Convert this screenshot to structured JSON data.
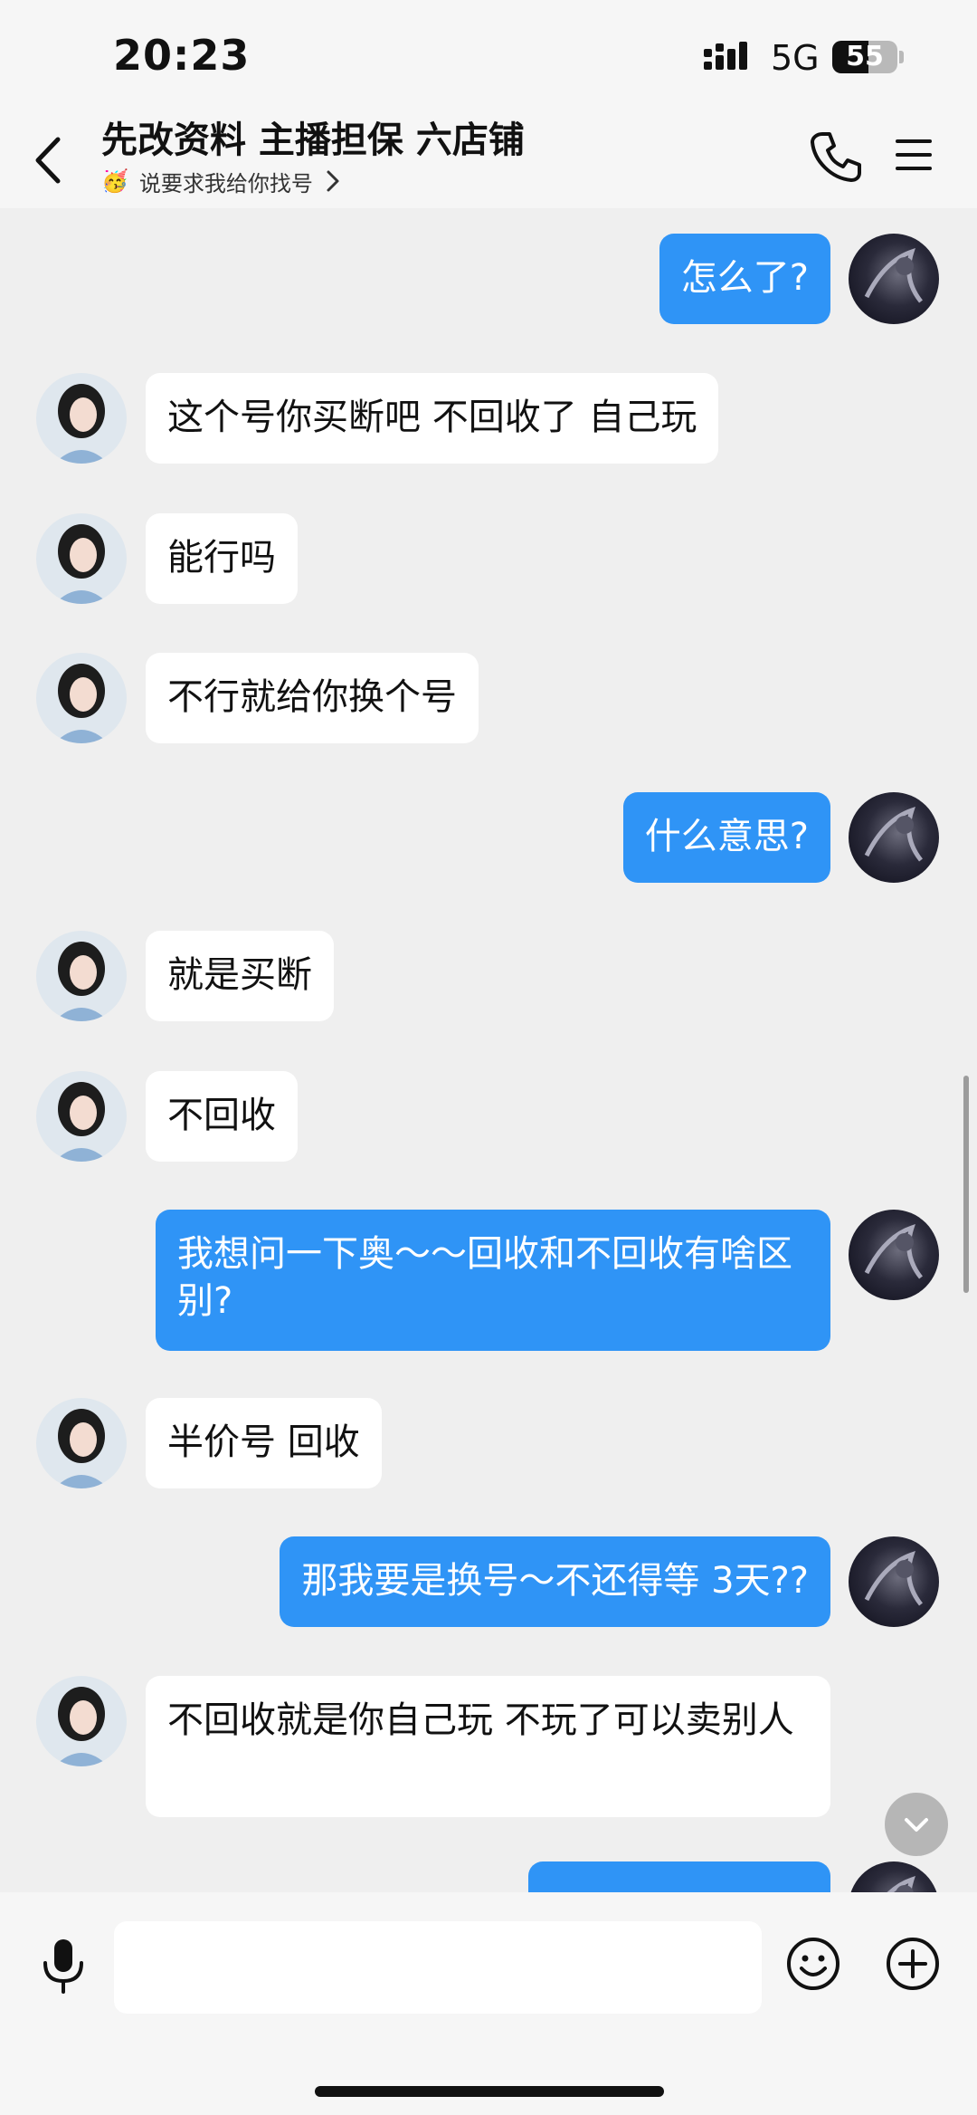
{
  "status_bar": {
    "time": "20:23",
    "network": "5G",
    "battery": "55",
    "battery_level": 0.55
  },
  "header": {
    "title": "先改资料 主播担保 六店铺",
    "subtitle_emoji": "🥳",
    "subtitle": "说要求我给你找号"
  },
  "messages": [
    {
      "side": "right",
      "text": "怎么了?"
    },
    {
      "side": "left",
      "text": "这个号你买断吧 不回收了 自己玩"
    },
    {
      "side": "left",
      "text": "能行吗"
    },
    {
      "side": "left",
      "text": "不行就给你换个号"
    },
    {
      "side": "right",
      "text": "什么意思?"
    },
    {
      "side": "left",
      "text": "就是买断"
    },
    {
      "side": "left",
      "text": "不回收"
    },
    {
      "side": "right",
      "text": "我想问一下奥～～回收和不回收有啥区别?"
    },
    {
      "side": "left",
      "text": "半价号 回收"
    },
    {
      "side": "right",
      "text": "那我要是换号～不还得等 3天??"
    },
    {
      "side": "left",
      "text": "不回收就是你自己玩 不玩了可以卖别人"
    },
    {
      "side": "right",
      "text": ""
    }
  ],
  "input": {
    "placeholder": ""
  },
  "colors": {
    "outgoing_bubble": "#2f94f6",
    "incoming_bubble": "#ffffff",
    "background": "#efefef"
  },
  "icons": {
    "back": "chevron-left-icon",
    "phone": "phone-icon",
    "menu": "menu-icon",
    "mic": "microphone-icon",
    "emoji": "smiley-icon",
    "plus": "plus-circle-icon",
    "scroll_down": "chevron-down-icon"
  }
}
